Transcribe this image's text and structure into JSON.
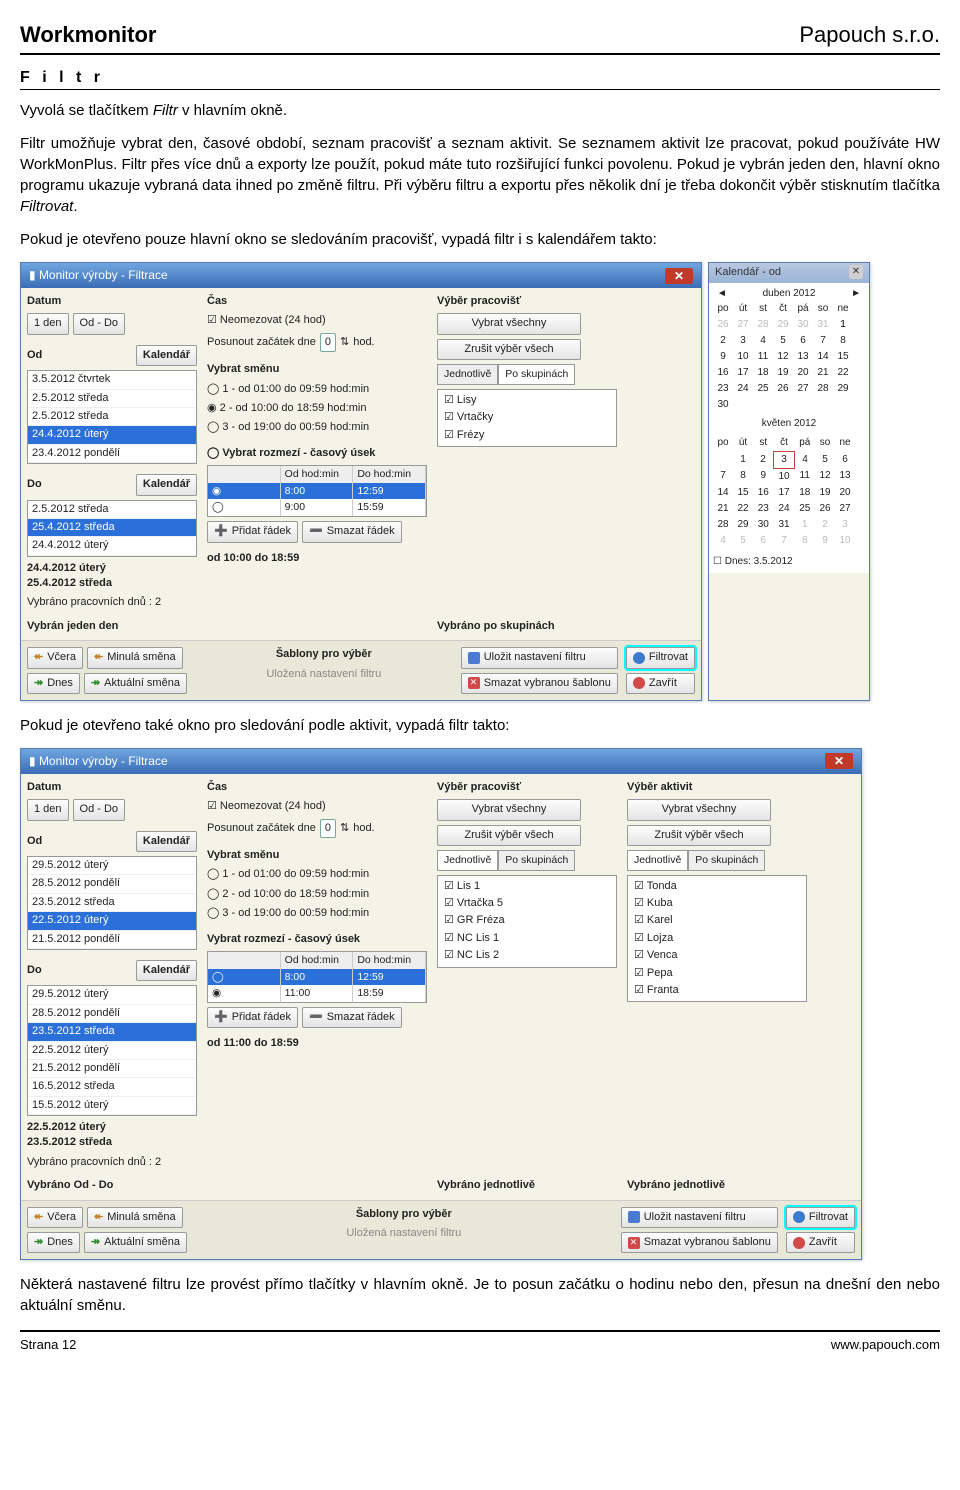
{
  "header": {
    "left": "Workmonitor",
    "right": "Papouch s.r.o."
  },
  "section": "F i l t r",
  "p1_pre": "Vyvolá se tlačítkem ",
  "p1_em": "Filtr",
  "p1_post": " v hlavním okně.",
  "p2": "Filtr umožňuje vybrat den, časové období, seznam pracovišť a seznam aktivit. Se seznamem aktivit lze pracovat, pokud používáte HW WorkMonPlus. Filtr přes více dnů a exporty lze použít, pokud máte tuto rozšiřující funkci povolenu. Pokud je vybrán jeden den, hlavní okno programu ukazuje vybraná data ihned po změně filtru. Při výběru filtru a exportu přes několik dní je třeba dokončit výběr stisknutím tlačítka ",
  "p2_em": "Filtrovat",
  "p2_post": ".",
  "p3": "Pokud je otevřeno pouze hlavní okno se sledováním pracovišť, vypadá filtr i s kalendářem takto:",
  "p4": "Pokud je otevřeno také okno pro sledování podle aktivit, vypadá filtr takto:",
  "p5": "Některá nastavené filtru lze provést přímo tlačítky v hlavním okně. Je to posun začátku o hodinu nebo den, přesun na dnešní den nebo aktuální směnu.",
  "footer": {
    "left": "Strana 12",
    "right": "www.papouch.com"
  },
  "win1": {
    "title": "Monitor výroby - Filtrace",
    "datum": "Datum",
    "cas": "Čas",
    "vybprac": "Výběr pracovišť",
    "oneday": "1 den",
    "oddo": "Od - Do",
    "od": "Od",
    "do": "Do",
    "kalbtn": "Kalendář",
    "odlist": [
      "3.5.2012 čtvrtek",
      "2.5.2012 středa",
      "2.5.2012 středa",
      "24.4.2012 úterý",
      "23.4.2012 pondělí"
    ],
    "odlist_sel": 3,
    "dolist": [
      "2.5.2012 středa",
      "25.4.2012 středa",
      "24.4.2012 úterý"
    ],
    "dolist_sel": 1,
    "boldrange": [
      "24.4.2012 úterý",
      "25.4.2012 středa"
    ],
    "vybrano": "Vybráno pracovních dnů : 2",
    "status": "Vybrán jeden den",
    "neomez": "Neomezovat (24 hod)",
    "posun": "Posunout začátek dne",
    "pos_v": "0",
    "hod": "hod.",
    "vybsm": "Vybrat směnu",
    "sm": [
      "1 - od 01:00 do 09:59 hod:min",
      "2 - od 10:00 do 18:59 hod:min",
      "3 - od 19:00 do 00:59 hod:min"
    ],
    "sm_sel": 1,
    "vybroz": "Vybrat rozmezí - časový úsek",
    "th": [
      "",
      "Od  hod:min",
      "Do  hod:min"
    ],
    "tr": [
      [
        "◉",
        "8:00",
        "12:59"
      ],
      [
        "◯",
        "9:00",
        "15:59"
      ]
    ],
    "add": "Přidat řádek",
    "del": "Smazat řádek",
    "timestat": "od  10:00  do  18:59",
    "vybvse": "Vybrat všechny",
    "zrusvse": "Zrušit výběr všech",
    "tab1": "Jednotlivě",
    "tab2": "Po skupinách",
    "groups": [
      "Lisy",
      "Vrtačky",
      "Frézy"
    ],
    "stat3": "Vybráno po skupinách",
    "btns": {
      "vcera": "Včera",
      "minula": "Minulá směna",
      "dnes": "Dnes",
      "akt": "Aktuální směna"
    },
    "sabl": "Šablony pro výběr",
    "sabl_sub": "Uložená nastavení filtru",
    "ulozit": "Uložit nastavení filtru",
    "smazat": "Smazat vybranou šablonu",
    "filtrovat": "Filtrovat",
    "zavrit": "Zavřít"
  },
  "cal": {
    "title": "Kalendář - od",
    "m1": "duben 2012",
    "m2": "květen 2012",
    "days": [
      "po",
      "út",
      "st",
      "čt",
      "pá",
      "so",
      "ne"
    ],
    "today": "Dnes: 3.5.2012"
  },
  "win2": {
    "title": "Monitor výroby - Filtrace",
    "datum": "Datum",
    "cas": "Čas",
    "vybprac": "Výběr pracovišť",
    "vybakt": "Výběr aktivit",
    "oneday": "1 den",
    "oddo": "Od - Do",
    "od": "Od",
    "do": "Do",
    "kalbtn": "Kalendář",
    "odlist": [
      "29.5.2012 úterý",
      "28.5.2012 pondělí",
      "23.5.2012 středa",
      "22.5.2012 úterý",
      "21.5.2012 pondělí"
    ],
    "odlist_sel": 3,
    "dolist": [
      "29.5.2012 úterý",
      "28.5.2012 pondělí",
      "23.5.2012 středa",
      "22.5.2012 úterý",
      "21.5.2012 pondělí",
      "16.5.2012 středa",
      "15.5.2012 úterý"
    ],
    "dolist_sel": 2,
    "boldrange": [
      "22.5.2012 úterý",
      "23.5.2012 středa"
    ],
    "vybrano": "Vybráno pracovních dnů : 2",
    "status": "Vybráno Od - Do",
    "neomez": "Neomezovat (24 hod)",
    "posun": "Posunout začátek dne",
    "pos_v": "0",
    "hod": "hod.",
    "vybsm": "Vybrat směnu",
    "sm": [
      "1 - od 01:00 do 09:59 hod:min",
      "2 - od 10:00 do 18:59 hod:min",
      "3 - od 19:00 do 00:59 hod:min"
    ],
    "vybroz": "Vybrat rozmezí - časový úsek",
    "th": [
      "",
      "Od  hod:min",
      "Do  hod:min"
    ],
    "tr": [
      [
        "◯",
        "8:00",
        "12:59"
      ],
      [
        "◉",
        "11:00",
        "18:59"
      ]
    ],
    "add": "Přidat řádek",
    "del": "Smazat řádek",
    "timestat": "od  11:00  do  18:59",
    "vybvse": "Vybrat všechny",
    "zrusvse": "Zrušit výběr všech",
    "tab1": "Jednotlivě",
    "tab2": "Po skupinách",
    "prac": [
      "Lis 1",
      "Vrtačka 5",
      "GR Fréza",
      "NC Lis 1",
      "NC Lis 2"
    ],
    "akt": [
      "Tonda",
      "Kuba",
      "Karel",
      "Lojza",
      "Venca",
      "Pepa",
      "Franta"
    ],
    "stat3": "Vybráno jednotlivě",
    "stat4": "Vybráno jednotlivě",
    "btns": {
      "vcera": "Včera",
      "minula": "Minulá směna",
      "dnes": "Dnes",
      "akt": "Aktuální směna"
    },
    "sabl": "Šablony pro výběr",
    "sabl_sub": "Uložená nastavení filtru",
    "ulozit": "Uložit nastavení filtru",
    "smazat": "Smazat vybranou šablonu",
    "filtrovat": "Filtrovat",
    "zavrit": "Zavřít"
  }
}
